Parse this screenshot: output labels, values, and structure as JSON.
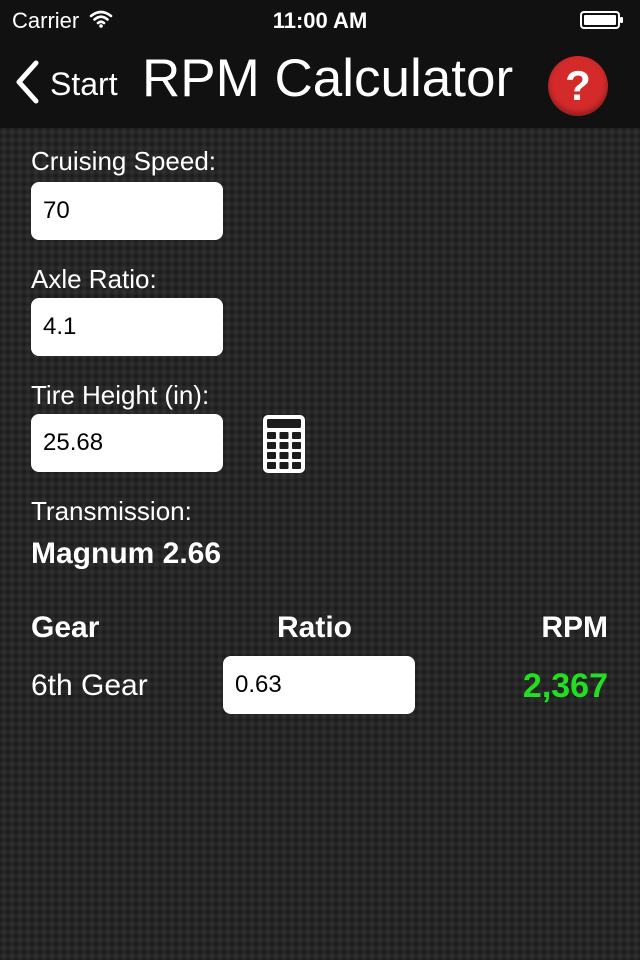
{
  "status_bar": {
    "carrier": "Carrier",
    "time": "11:00 AM"
  },
  "nav": {
    "back_label": "Start",
    "title": "RPM Calculator",
    "help_glyph": "?"
  },
  "form": {
    "cruising_speed": {
      "label": "Cruising Speed:",
      "value": "70"
    },
    "axle_ratio": {
      "label": "Axle Ratio:",
      "value": "4.1"
    },
    "tire_height": {
      "label": "Tire Height (in):",
      "value": "25.68"
    },
    "transmission": {
      "label": "Transmission:",
      "value": "Magnum 2.66"
    }
  },
  "table": {
    "headers": {
      "gear": "Gear",
      "ratio": "Ratio",
      "rpm": "RPM"
    },
    "rows": [
      {
        "gear": "6th Gear",
        "ratio": "0.63",
        "rpm": "2,367"
      }
    ]
  },
  "colors": {
    "rpm_value": "#22e01f",
    "help_button": "#d42a2a",
    "nav_bar": "#111111",
    "background": "#262626"
  },
  "icons": {
    "back": "chevron-left-icon",
    "help": "question-mark-icon",
    "calculator": "calculator-icon",
    "wifi": "wifi-icon",
    "battery": "battery-icon"
  }
}
